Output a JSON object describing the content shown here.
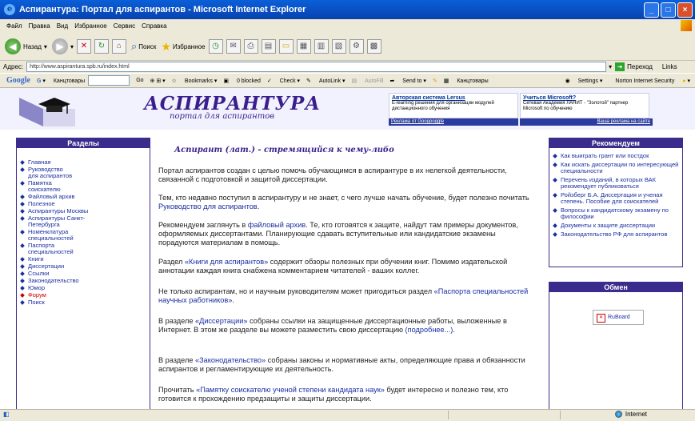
{
  "window": {
    "title": "Аспирантура: Портал для аспирантов - Microsoft Internet Explorer"
  },
  "menu": [
    "Файл",
    "Правка",
    "Вид",
    "Избранное",
    "Сервис",
    "Справка"
  ],
  "toolbar": {
    "back": "Назад",
    "search": "Поиск",
    "favorites": "Избранное"
  },
  "address": {
    "label": "Адрес:",
    "url": "http://www.aspirantura.spb.ru/index.html",
    "go": "Переход",
    "links": "Links"
  },
  "google_toolbar": {
    "brand": "Google",
    "field": "Канцтовары",
    "go": "Go",
    "bookmarks": "Bookmarks",
    "blocked": "0 blocked",
    "check": "Check",
    "autolink": "AutoLink",
    "autofill": "AutoFill",
    "sendto": "Send to",
    "field2": "Канцтовары",
    "settings": "Settings",
    "norton": "Norton Internet Security"
  },
  "site": {
    "title": "АСПИРАНТУРА",
    "subtitle": "портал для аспирантов"
  },
  "ads": [
    {
      "title": "Авторская система Lersus",
      "text": "E-learning решения для организации модулей дистанционного обучения"
    },
    {
      "title": "Учиться Microsoft?",
      "text": "Сетевая Академия ЛАНИТ - \"Золотой\" партнер Microsoft по обучению"
    }
  ],
  "ad_footer": {
    "left": "Реклама от Googooggle",
    "right": "Ваша реклама на сайте"
  },
  "sidebar": {
    "heading": "Разделы",
    "items": [
      "Главная",
      "Руководство для аспирантов",
      "Памятка соискателю",
      "Файловый архив",
      "Полезное",
      "Аспирантуры Москвы",
      "Аспирантуры Санкт-Петербурга",
      "Номенклатура специальностей",
      "Паспорта специальностей",
      "Книги",
      "Диссертации",
      "Ссылки",
      "Законодательство",
      "Юмор",
      "Форум",
      "Поиск"
    ]
  },
  "main": {
    "slogan": "Аспирант (лат.) - стремящийся к чему-либо",
    "p1": "Портал аспирантов создан с целью помочь обучающимся в аспирантуре в их нелегкой деятельности, связанной с подготовкой и защитой диссертации.",
    "p2a": "Тем, кто недавно поступил в аспирантуру и не знает, с чего лучше начать обучение, будет полезно почитать ",
    "p2link": "Руководство для аспирантов",
    "p2b": ".",
    "p3a": "Рекомендуем заглянуть в ",
    "p3link": "файловый архив",
    "p3b": ". Те, кто готовятся к защите, найдут там примеры документов, оформляемых диссертантами. Планирующие сдавать вступительные или кандидатские экзамены порадуются материалам в помощь.",
    "p4a": "Раздел ",
    "p4link": "«Книги для аспирантов»",
    "p4b": " содержит обзоры полезных при обучении книг. Помимо издательской аннотации каждая книга снабжена комментарием читателей - ваших коллег.",
    "p5a": "Не только аспирантам, но и научным руководителям может пригодиться раздел ",
    "p5link": "«Паспорта специальностей научных работников»",
    "p5b": ".",
    "p6a": "В разделе ",
    "p6link": "«Диссертации»",
    "p6b": " собраны ссылки на защищенные диссертационные работы, выложенные в Интернет. В этом же разделе вы можете разместить свою диссертацию ",
    "p6link2": "(подробнее...)",
    "p6c": ".",
    "p7a": "В разделе ",
    "p7link": "«Законодательство»",
    "p7b": " собраны законы и нормативные акты, определяющие права и обязанности аспирантов и регламентирующие их деятельность.",
    "p8a": "Прочитать ",
    "p8link": "«Памятку соискателю ученой степени кандидата наук»",
    "p8b": " будет интересно и полезно тем, кто готовится к прохождению предзащиты и защиты диссертации."
  },
  "recommend": {
    "heading": "Рекомендуем",
    "items": [
      "Как выиграть грант или постдок",
      "Как искать диссертации по интересующей специальности",
      "Перечень изданий, в которых ВАК рекомендует публиковаться",
      "Ройзберг Б.А. Диссертация и ученая степень. Пособие для соискателей",
      "Вопросы к кандидатскому экзамену по философии",
      "Документы к защите диссертации",
      "Законодательство РФ для аспирантов"
    ]
  },
  "exchange": {
    "heading": "Обмен",
    "ruboard": "RuBoard"
  },
  "status": {
    "zone": "Internet"
  }
}
